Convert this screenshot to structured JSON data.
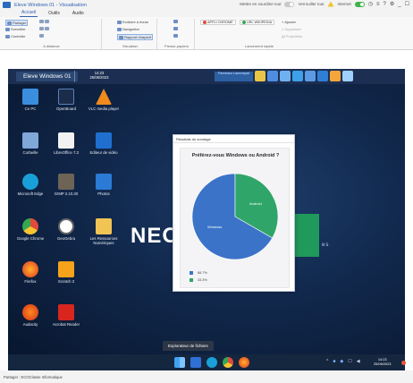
{
  "window": {
    "title": "Eleve Windows 01 - Visualisation",
    "controls": [
      "?",
      "⚙",
      "_",
      "☐"
    ]
  },
  "titlebar_right": {
    "toggle1_label": "Mettre en sourdine tout",
    "toggle2_label": "Verrouiller tout",
    "internet_label": "Internet"
  },
  "tabs": [
    "Accueil",
    "Outils",
    "Audio"
  ],
  "ribbon": {
    "groups": [
      {
        "name": "A distance",
        "items": [
          "Partager",
          "Surveiller",
          "Contrôler"
        ]
      },
      {
        "name": "Visualiser",
        "items": [
          "Ecritoire à écran",
          "Navigation",
          "Rapport d'aspect"
        ]
      },
      {
        "name": "Presse-papiers",
        "items": []
      },
      {
        "name": "Lancement rapide",
        "items": [
          "APPLI CHROME",
          "URL WIKIPEDIA",
          "Ajouter",
          "Supprimer",
          "Propriétés"
        ]
      }
    ]
  },
  "remote": {
    "workspace_label": "Eleve Windows 01",
    "time": "14:23",
    "date": "25/06/2023",
    "chip_text": "Panneaux Launchpad"
  },
  "desktop_icons": [
    {
      "label": "Ce PC"
    },
    {
      "label": "OpenBoard"
    },
    {
      "label": "VLC media player"
    },
    {
      "label": "Corbeille"
    },
    {
      "label": "LibreOffice 7.3"
    },
    {
      "label": "Editeur de vidéo"
    },
    {
      "label": "Microsoft Edge"
    },
    {
      "label": "GIMP 2.10.30"
    },
    {
      "label": "Photos"
    },
    {
      "label": "Google Chrome"
    },
    {
      "label": "GeoGebra"
    },
    {
      "label": "Les Ressources Numériques"
    },
    {
      "label": "Firefox"
    },
    {
      "label": "Scratch 3"
    },
    {
      "label": "Audacity"
    },
    {
      "label": "Acrobat Reader"
    }
  ],
  "neo": {
    "text": "NEO",
    "sub": "es"
  },
  "poll": {
    "window_title": "Résultats du sondage",
    "question": "Préférez-vous Windows ou Android ?",
    "colors": {
      "windows": "#3b73c8",
      "android": "#2fa56a"
    }
  },
  "chart_data": {
    "type": "pie",
    "title": "Préférez-vous Windows ou Android ?",
    "series": [
      {
        "name": "Windows",
        "values": [
          66.7
        ]
      },
      {
        "name": "Android",
        "values": [
          33.3
        ]
      }
    ],
    "slice_labels": [
      "Windows",
      "Android"
    ],
    "legend": [
      "66.7%",
      "33.3%"
    ]
  },
  "tooltip": "Explorateur de fichiers",
  "taskbar": {
    "time": "14:23",
    "date": "25/06/2023"
  },
  "status": "Partager : ECOClasse Informatique"
}
